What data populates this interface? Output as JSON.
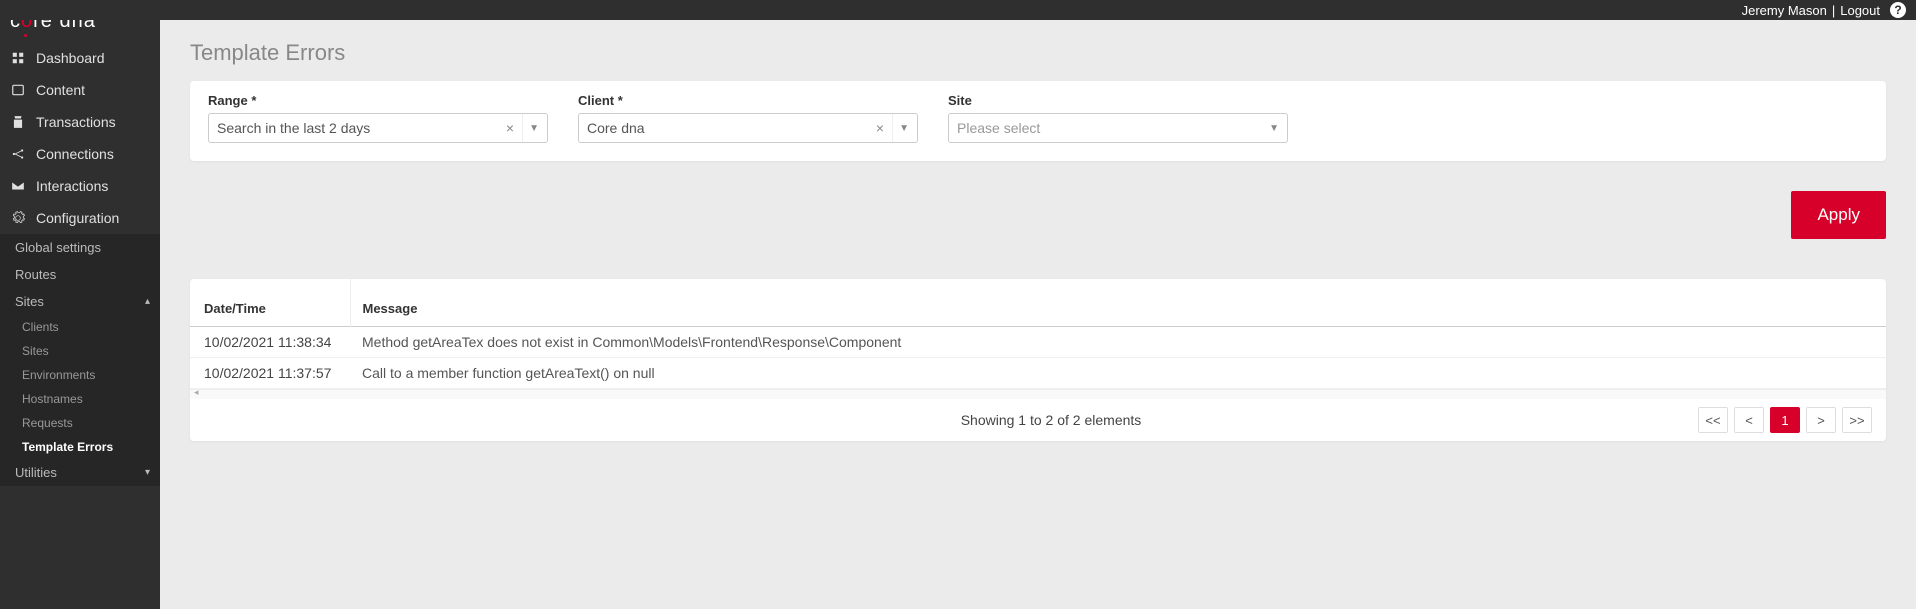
{
  "topbar": {
    "username": "Jeremy Mason",
    "logout": "Logout"
  },
  "logo": {
    "part1": "c",
    "o": "o",
    "part2": "re",
    "part3": "dna"
  },
  "nav": {
    "items": [
      {
        "label": "Dashboard"
      },
      {
        "label": "Content"
      },
      {
        "label": "Transactions"
      },
      {
        "label": "Connections"
      },
      {
        "label": "Interactions"
      },
      {
        "label": "Configuration"
      }
    ],
    "config_sub": [
      {
        "label": "Global settings"
      },
      {
        "label": "Routes"
      },
      {
        "label": "Sites",
        "expanded": true,
        "children": [
          {
            "label": "Clients"
          },
          {
            "label": "Sites"
          },
          {
            "label": "Environments"
          },
          {
            "label": "Hostnames"
          },
          {
            "label": "Requests"
          },
          {
            "label": "Template Errors",
            "active": true
          }
        ]
      },
      {
        "label": "Utilities",
        "expanded": false
      }
    ]
  },
  "page": {
    "title": "Template Errors",
    "filters": {
      "range": {
        "label": "Range *",
        "value": "Search in the last 2 days"
      },
      "client": {
        "label": "Client *",
        "value": "Core dna"
      },
      "site": {
        "label": "Site",
        "placeholder": "Please select"
      }
    },
    "apply_label": "Apply"
  },
  "table": {
    "headers": {
      "datetime": "Date/Time",
      "message": "Message"
    },
    "rows": [
      {
        "datetime": "10/02/2021 11:38:34",
        "message": "Method getAreaTex does not exist in Common\\Models\\Frontend\\Response\\Component"
      },
      {
        "datetime": "10/02/2021 11:37:57",
        "message": "Call to a member function getAreaText() on null"
      }
    ],
    "footer": {
      "summary": "Showing 1 to 2 of 2 elements",
      "first": "<<",
      "prev": "<",
      "page": "1",
      "next": ">",
      "last": ">>"
    }
  }
}
